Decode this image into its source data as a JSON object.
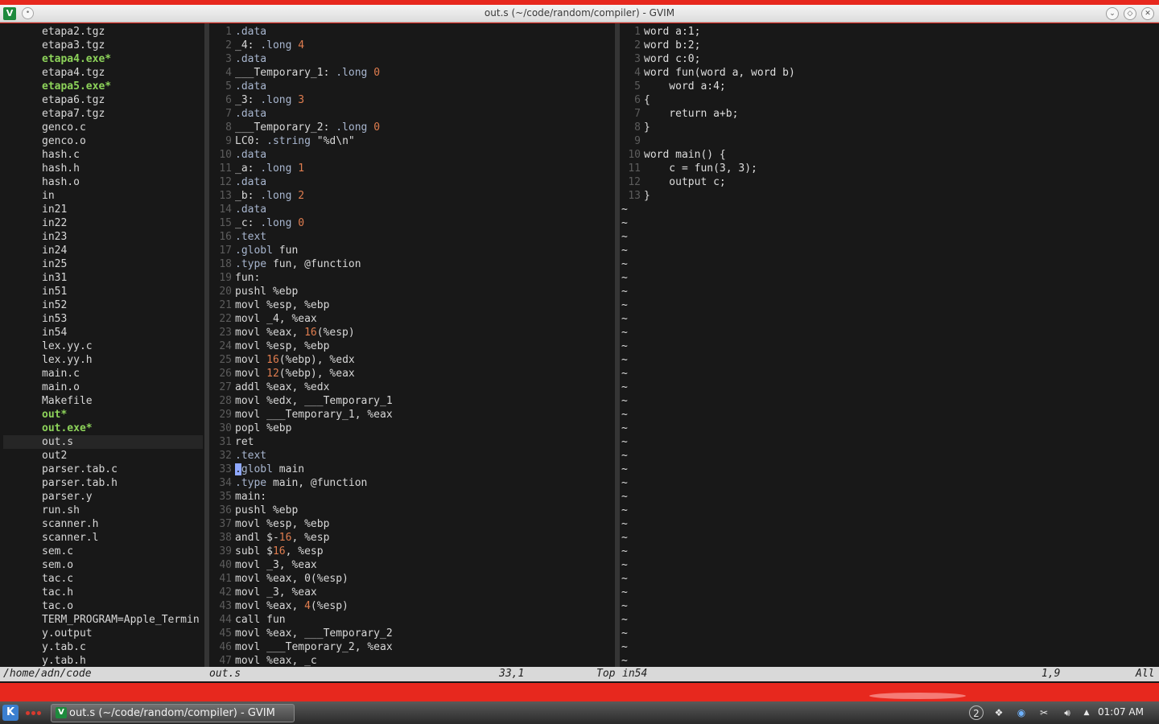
{
  "window": {
    "title": "out.s (~/code/random/compiler) - GVIM",
    "app_icon": "vim-icon"
  },
  "files": [
    {
      "name": "etapa2.tgz"
    },
    {
      "name": "etapa3.tgz"
    },
    {
      "name": "etapa4.exe*",
      "exe": true
    },
    {
      "name": "etapa4.tgz"
    },
    {
      "name": "etapa5.exe*",
      "exe": true
    },
    {
      "name": "etapa6.tgz"
    },
    {
      "name": "etapa7.tgz"
    },
    {
      "name": "genco.c"
    },
    {
      "name": "genco.o"
    },
    {
      "name": "hash.c"
    },
    {
      "name": "hash.h"
    },
    {
      "name": "hash.o"
    },
    {
      "name": "in"
    },
    {
      "name": "in21"
    },
    {
      "name": "in22"
    },
    {
      "name": "in23"
    },
    {
      "name": "in24"
    },
    {
      "name": "in25"
    },
    {
      "name": "in31"
    },
    {
      "name": "in51"
    },
    {
      "name": "in52"
    },
    {
      "name": "in53"
    },
    {
      "name": "in54"
    },
    {
      "name": "lex.yy.c"
    },
    {
      "name": "lex.yy.h"
    },
    {
      "name": "main.c"
    },
    {
      "name": "main.o"
    },
    {
      "name": "Makefile"
    },
    {
      "name": "out*",
      "exe": true
    },
    {
      "name": "out.exe*",
      "exe": true
    },
    {
      "name": "out.s",
      "current": true
    },
    {
      "name": "out2"
    },
    {
      "name": "parser.tab.c"
    },
    {
      "name": "parser.tab.h"
    },
    {
      "name": "parser.y"
    },
    {
      "name": "run.sh"
    },
    {
      "name": "scanner.h"
    },
    {
      "name": "scanner.l"
    },
    {
      "name": "sem.c"
    },
    {
      "name": "sem.o"
    },
    {
      "name": "tac.c"
    },
    {
      "name": "tac.h"
    },
    {
      "name": "tac.o"
    },
    {
      "name": "TERM_PROGRAM=Apple_Termin"
    },
    {
      "name": "y.output"
    },
    {
      "name": "y.tab.c"
    },
    {
      "name": "y.tab.h"
    }
  ],
  "asm_lines": [
    [
      [
        "d",
        ".data"
      ]
    ],
    [
      [
        "t",
        "_4: "
      ],
      [
        "d",
        ".long "
      ],
      [
        "n",
        "4"
      ]
    ],
    [
      [
        "d",
        ".data"
      ]
    ],
    [
      [
        "t",
        "___Temporary_1: "
      ],
      [
        "d",
        ".long "
      ],
      [
        "n",
        "0"
      ]
    ],
    [
      [
        "d",
        ".data"
      ]
    ],
    [
      [
        "t",
        "_3: "
      ],
      [
        "d",
        ".long "
      ],
      [
        "n",
        "3"
      ]
    ],
    [
      [
        "d",
        ".data"
      ]
    ],
    [
      [
        "t",
        "___Temporary_2: "
      ],
      [
        "d",
        ".long "
      ],
      [
        "n",
        "0"
      ]
    ],
    [
      [
        "t",
        "LC0: "
      ],
      [
        "d",
        ".string "
      ],
      [
        "t",
        "\"%d\\n\""
      ]
    ],
    [
      [
        "d",
        ".data"
      ]
    ],
    [
      [
        "t",
        "_a: "
      ],
      [
        "d",
        ".long "
      ],
      [
        "n",
        "1"
      ]
    ],
    [
      [
        "d",
        ".data"
      ]
    ],
    [
      [
        "t",
        "_b: "
      ],
      [
        "d",
        ".long "
      ],
      [
        "n",
        "2"
      ]
    ],
    [
      [
        "d",
        ".data"
      ]
    ],
    [
      [
        "t",
        "_c: "
      ],
      [
        "d",
        ".long "
      ],
      [
        "n",
        "0"
      ]
    ],
    [
      [
        "d",
        ".text"
      ]
    ],
    [
      [
        "d",
        ".globl "
      ],
      [
        "t",
        "fun"
      ]
    ],
    [
      [
        "d",
        ".type "
      ],
      [
        "t",
        "fun, @function"
      ]
    ],
    [
      [
        "t",
        "fun:"
      ]
    ],
    [
      [
        "t",
        "pushl %ebp"
      ]
    ],
    [
      [
        "t",
        "movl %esp, %ebp"
      ]
    ],
    [
      [
        "t",
        "movl _4, %eax"
      ]
    ],
    [
      [
        "t",
        "movl %eax, "
      ],
      [
        "n",
        "16"
      ],
      [
        "t",
        "(%esp)"
      ]
    ],
    [
      [
        "t",
        "movl %esp, %ebp"
      ]
    ],
    [
      [
        "t",
        "movl "
      ],
      [
        "n",
        "16"
      ],
      [
        "t",
        "(%ebp), %edx"
      ]
    ],
    [
      [
        "t",
        "movl "
      ],
      [
        "n",
        "12"
      ],
      [
        "t",
        "(%ebp), %eax"
      ]
    ],
    [
      [
        "t",
        "addl %eax, %edx"
      ]
    ],
    [
      [
        "t",
        "movl %edx, ___Temporary_1"
      ]
    ],
    [
      [
        "t",
        "movl ___Temporary_1, %eax"
      ]
    ],
    [
      [
        "t",
        "popl %ebp"
      ]
    ],
    [
      [
        "t",
        "ret"
      ]
    ],
    [
      [
        "d",
        ".text"
      ]
    ],
    [
      [
        "c",
        "."
      ],
      [
        "d",
        "globl "
      ],
      [
        "t",
        "main"
      ]
    ],
    [
      [
        "d",
        ".type "
      ],
      [
        "t",
        "main, @function"
      ]
    ],
    [
      [
        "t",
        "main:"
      ]
    ],
    [
      [
        "t",
        "pushl %ebp"
      ]
    ],
    [
      [
        "t",
        "movl %esp, %ebp"
      ]
    ],
    [
      [
        "t",
        "andl $-"
      ],
      [
        "n",
        "16"
      ],
      [
        "t",
        ", %esp"
      ]
    ],
    [
      [
        "t",
        "subl $"
      ],
      [
        "n",
        "16"
      ],
      [
        "t",
        ", %esp"
      ]
    ],
    [
      [
        "t",
        "movl _3, %eax"
      ]
    ],
    [
      [
        "t",
        "movl %eax, 0(%esp)"
      ]
    ],
    [
      [
        "t",
        "movl _3, %eax"
      ]
    ],
    [
      [
        "t",
        "movl %eax, "
      ],
      [
        "n",
        "4"
      ],
      [
        "t",
        "(%esp)"
      ]
    ],
    [
      [
        "t",
        "call fun"
      ]
    ],
    [
      [
        "t",
        "movl %eax, ___Temporary_2"
      ]
    ],
    [
      [
        "t",
        "movl ___Temporary_2, %eax"
      ]
    ],
    [
      [
        "t",
        "movl %eax, _c"
      ]
    ]
  ],
  "src_lines": [
    "word a:1;",
    "word b:2;",
    "word c:0;",
    "word fun(word a, word b)",
    "    word a:4;",
    "{",
    "    return a+b;",
    "}",
    "",
    "word main() {",
    "    c = fun(3, 3);",
    "    output c;",
    "}"
  ],
  "tilde_count": 34,
  "status": {
    "files_path": "/home/adn/code",
    "asm_file": "out.s",
    "asm_pos": "33,1",
    "asm_scroll": "Top",
    "src_file": "in54",
    "src_pos": "1,9",
    "src_scroll": "All"
  },
  "taskbar": {
    "task_title": "out.s (~/code/random/compiler) - GVIM",
    "tray_count": "2",
    "clock": "01:07 AM"
  },
  "colors": {
    "background": "#181818",
    "executable": "#8dd35a",
    "directive": "#a8b6cf",
    "number": "#e07d4f",
    "desktop_red": "#e7281e"
  }
}
